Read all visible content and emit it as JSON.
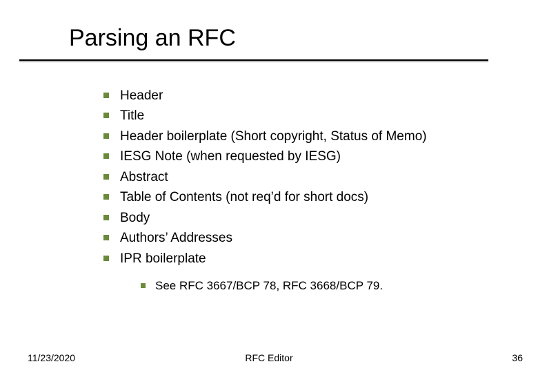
{
  "title": "Parsing an RFC",
  "items": [
    "Header",
    "Title",
    "Header boilerplate (Short copyright, Status of Memo)",
    "IESG Note (when requested by IESG)",
    "Abstract",
    "Table of Contents (not req’d for short docs)",
    "Body",
    "Authors’ Addresses",
    "IPR boilerplate"
  ],
  "subitems": [
    "See RFC 3667/BCP 78, RFC 3668/BCP 79."
  ],
  "footer": {
    "date": "11/23/2020",
    "center": "RFC Editor",
    "page": "36"
  }
}
